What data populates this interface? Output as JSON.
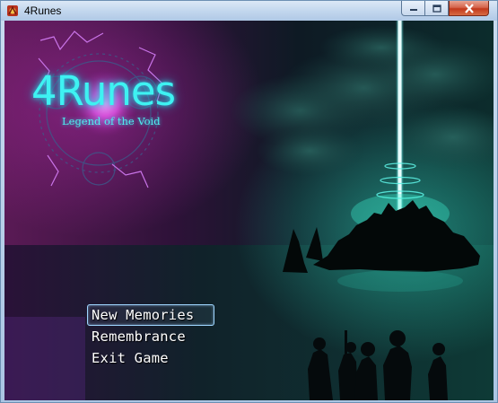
{
  "window": {
    "title": "4Runes",
    "app_icon": "rpg-maker-icon",
    "controls": {
      "minimize": "minimize-icon",
      "maximize": "maximize-icon",
      "close": "close-icon"
    }
  },
  "logo": {
    "title": "4Runes",
    "subtitle": "Legend of the Void"
  },
  "menu": {
    "items": [
      {
        "label": "New Memories",
        "selected": true
      },
      {
        "label": "Remembrance",
        "selected": false
      },
      {
        "label": "Exit Game",
        "selected": false
      }
    ]
  },
  "colors": {
    "accent_cyan": "#3ef2f2",
    "sky_magenta": "#4a1648",
    "sea_teal": "#0c2a2a",
    "cursor_border": "#9fd6ff"
  }
}
